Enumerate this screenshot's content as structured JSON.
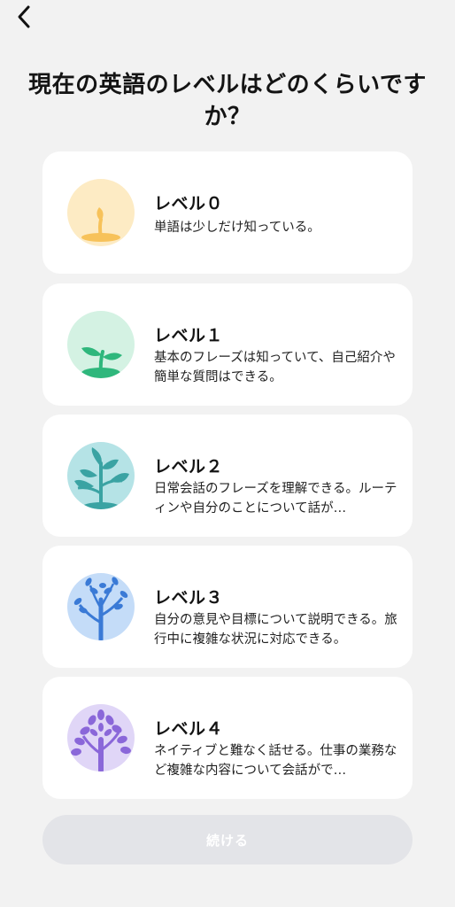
{
  "header": {
    "back_icon": "chevron-left-icon"
  },
  "title": "現在の英語のレベルはどのくらいですか？",
  "levels": [
    {
      "label": "レベル０",
      "description": "単語は少しだけ知っている。",
      "icon": "sprout-bud-icon",
      "color": "#fdebc4",
      "accent": "#f7c25a"
    },
    {
      "label": "レベル１",
      "description": "基本のフレーズは知っていて、自己紹介や簡単な質問はできる。",
      "icon": "seedling-icon",
      "color": "#d4f2e3",
      "accent": "#2fb77c"
    },
    {
      "label": "レベル２",
      "description": "日常会話のフレーズを理解できる。ルーティンや自分のことについて話が…",
      "icon": "young-plant-icon",
      "color": "#b5e3e6",
      "accent": "#3aa3a3"
    },
    {
      "label": "レベル３",
      "description": "自分の意見や目標について説明できる。旅行中に複雑な状況に対応できる。",
      "icon": "blue-tree-icon",
      "color": "#c4dcf8",
      "accent": "#3a7ad6"
    },
    {
      "label": "レベル４",
      "description": "ネイティブと難なく話せる。仕事の業務など複雑な内容について会話がで…",
      "icon": "purple-tree-icon",
      "color": "#e0d6f7",
      "accent": "#8a67d9"
    }
  ],
  "continue_label": "続ける"
}
